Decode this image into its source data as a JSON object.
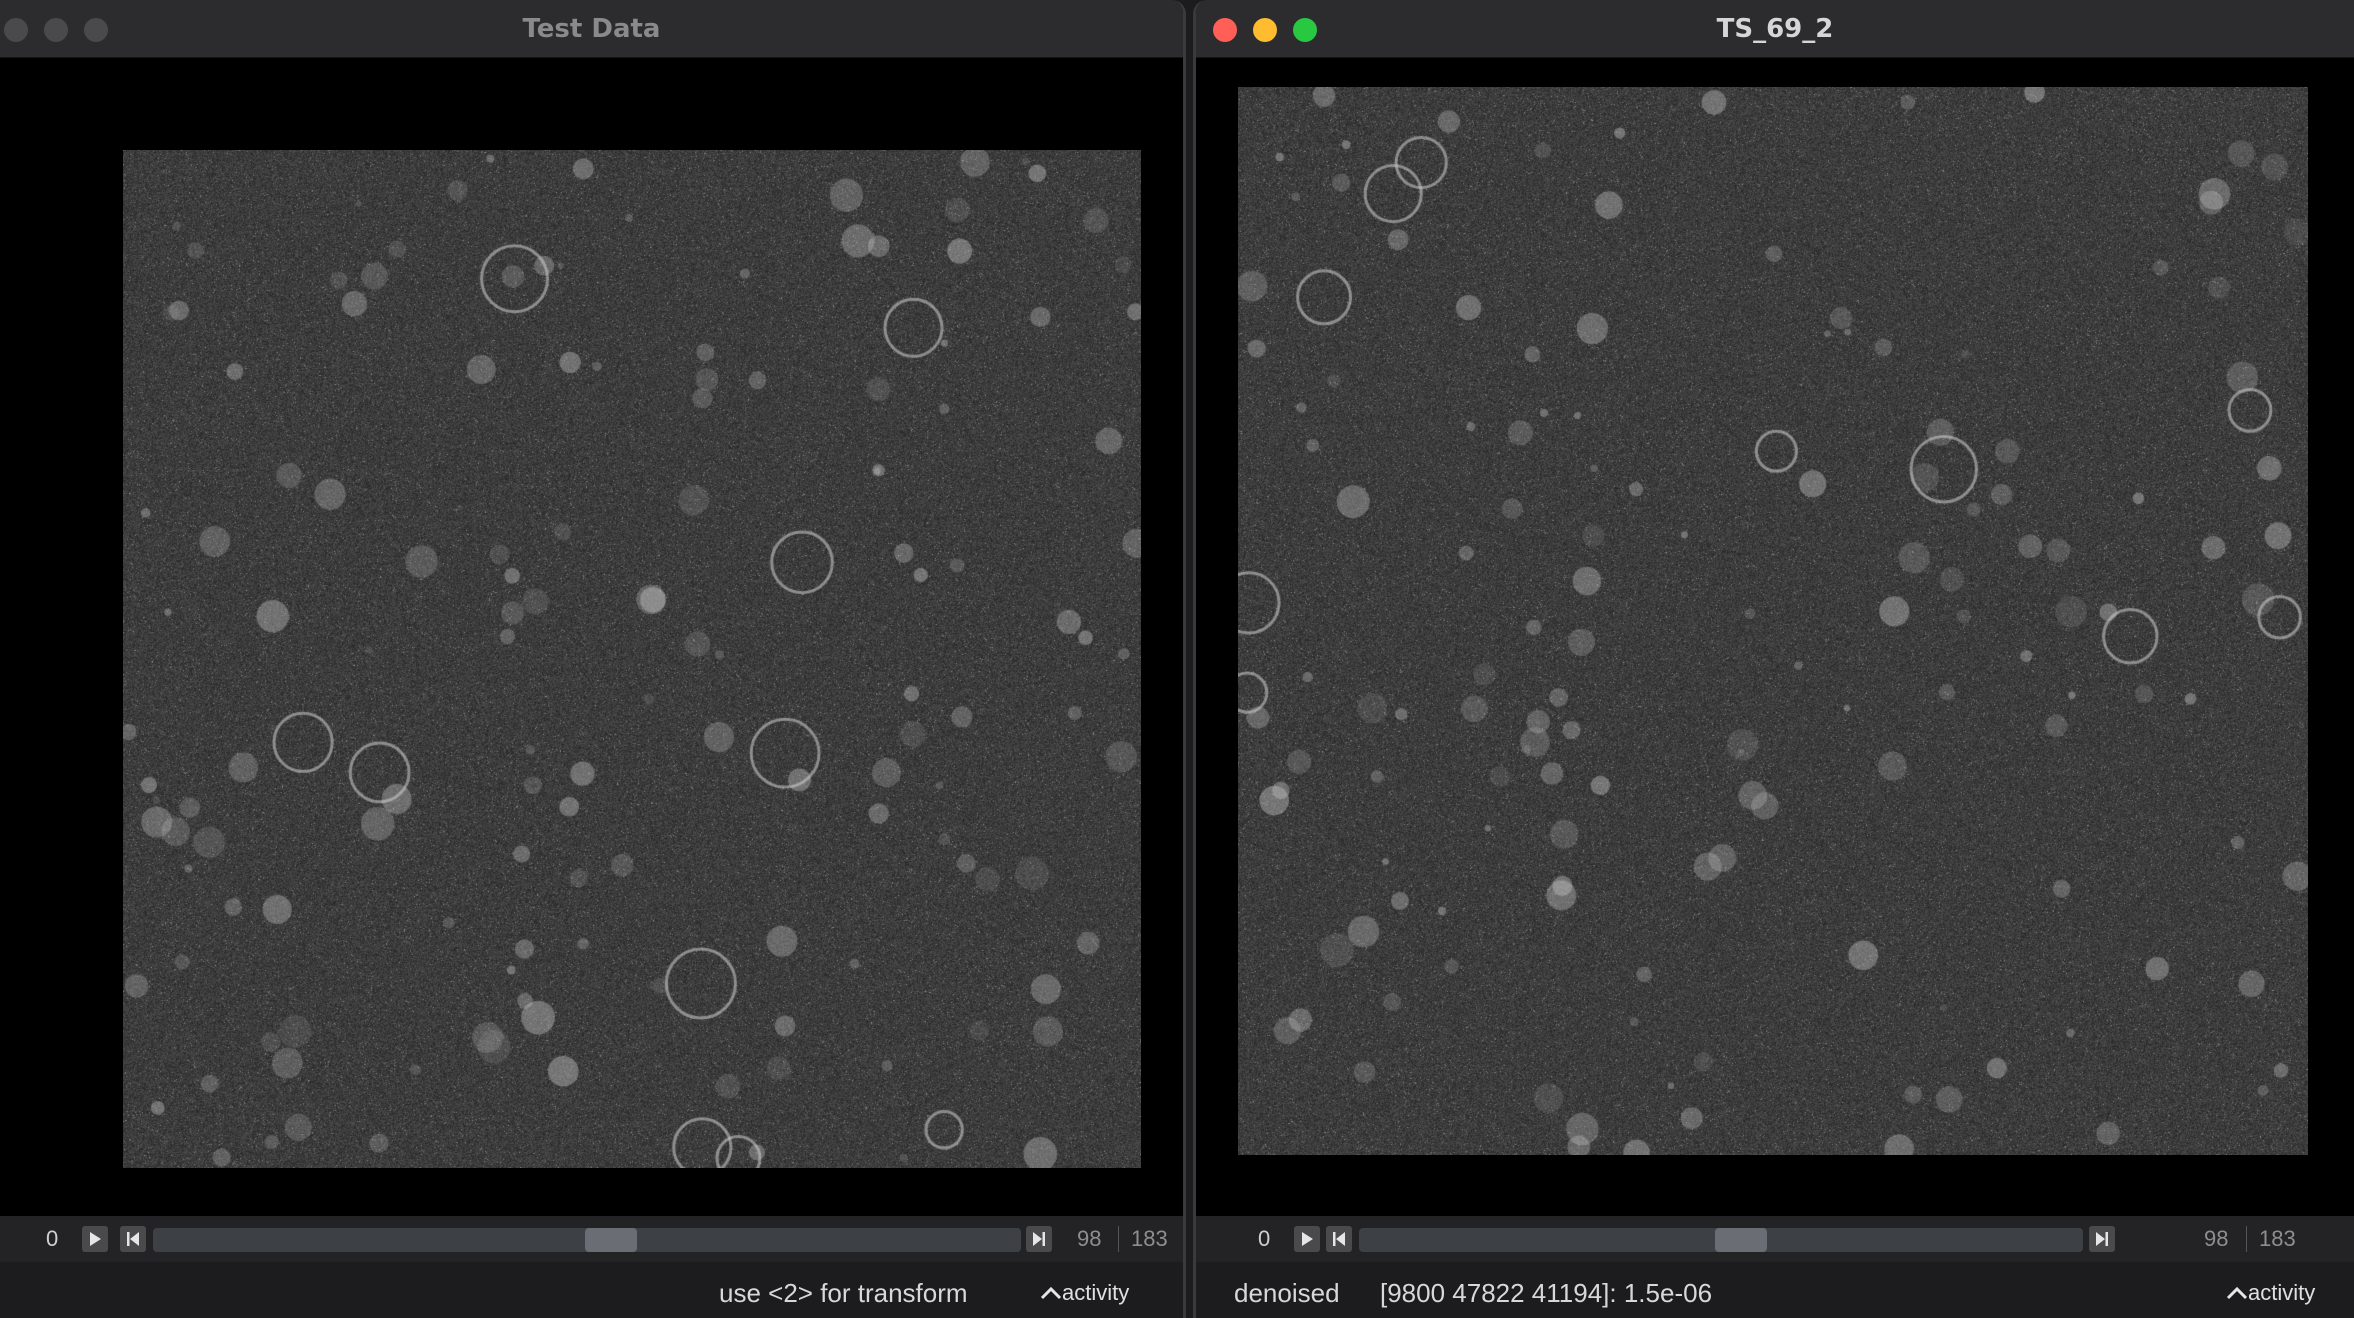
{
  "left_window": {
    "title": "Test Data",
    "frame_label": "0",
    "frame_number": "98",
    "frame_total": "183",
    "slider_position": 0.53,
    "status_text": "use <2> for transform",
    "activity_label": "activity"
  },
  "right_window": {
    "title": "TS_69_2",
    "frame_label": "0",
    "frame_number": "98",
    "frame_total": "183",
    "slider_position": 0.53,
    "status_label": "denoised",
    "status_info": "[9800 47822 41194]: 1.5e-06",
    "activity_label": "activity"
  },
  "colors": {
    "close": "#ff5f57",
    "minimize": "#febc2e",
    "zoom": "#28c840"
  },
  "icons": {
    "play": "play-icon",
    "step_back": "step-back-icon",
    "step_forward": "step-forward-icon",
    "chevron_up": "chevron-up-icon"
  }
}
